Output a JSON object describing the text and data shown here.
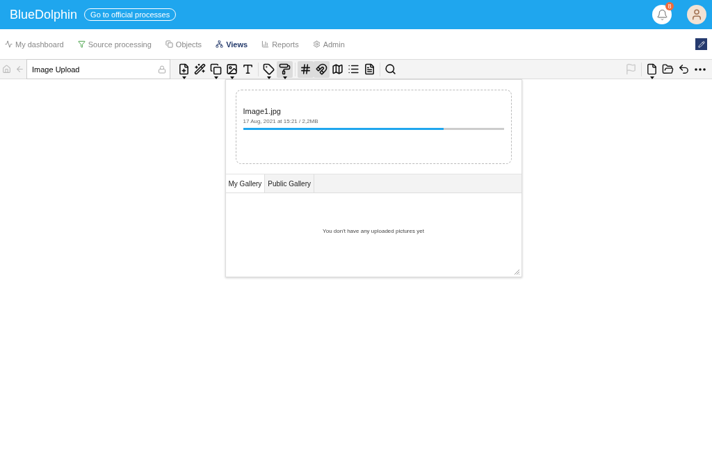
{
  "header": {
    "brand": "BlueDolphin",
    "process_button": "Go to official processes",
    "notification_count": "8"
  },
  "nav": [
    {
      "label": "My dashboard",
      "selected": false
    },
    {
      "label": "Source processing",
      "selected": false
    },
    {
      "label": "Objects",
      "selected": false
    },
    {
      "label": "Views",
      "selected": true
    },
    {
      "label": "Reports",
      "selected": false
    },
    {
      "label": "Admin",
      "selected": false
    }
  ],
  "toolbar": {
    "view_name": "Image Upload",
    "locked": true,
    "tools": [
      {
        "pressed": false,
        "dropdown": true
      },
      {
        "pressed": false,
        "dropdown": false
      },
      {
        "pressed": false,
        "dropdown": true
      },
      {
        "pressed": false,
        "dropdown": true
      },
      {
        "pressed": false,
        "dropdown": false
      },
      {
        "pressed": false,
        "dropdown": true
      },
      {
        "pressed": true,
        "dropdown": true
      },
      {
        "pressed": true,
        "dropdown": false
      },
      {
        "pressed": true,
        "dropdown": false
      },
      {
        "pressed": false,
        "dropdown": false
      },
      {
        "pressed": false,
        "dropdown": false
      },
      {
        "pressed": false,
        "dropdown": false
      },
      {
        "pressed": false,
        "dropdown": false
      }
    ],
    "right_tools": [
      {
        "disabled": true,
        "dropdown": false
      },
      {
        "disabled": false,
        "dropdown": true
      },
      {
        "disabled": false,
        "dropdown": false
      },
      {
        "disabled": false,
        "dropdown": false
      },
      {
        "disabled": false,
        "dropdown": false
      }
    ]
  },
  "upload": {
    "file_name": "Image1.jpg",
    "meta": "17 Aug, 2021 at 15:21 / 2,2MB",
    "level": 0.77
  },
  "tabs": [
    {
      "label": "My Gallery",
      "selected": true
    },
    {
      "label": "Public Gallery",
      "selected": false
    }
  ],
  "empty_message": "You don't have any uploaded pictures yet"
}
